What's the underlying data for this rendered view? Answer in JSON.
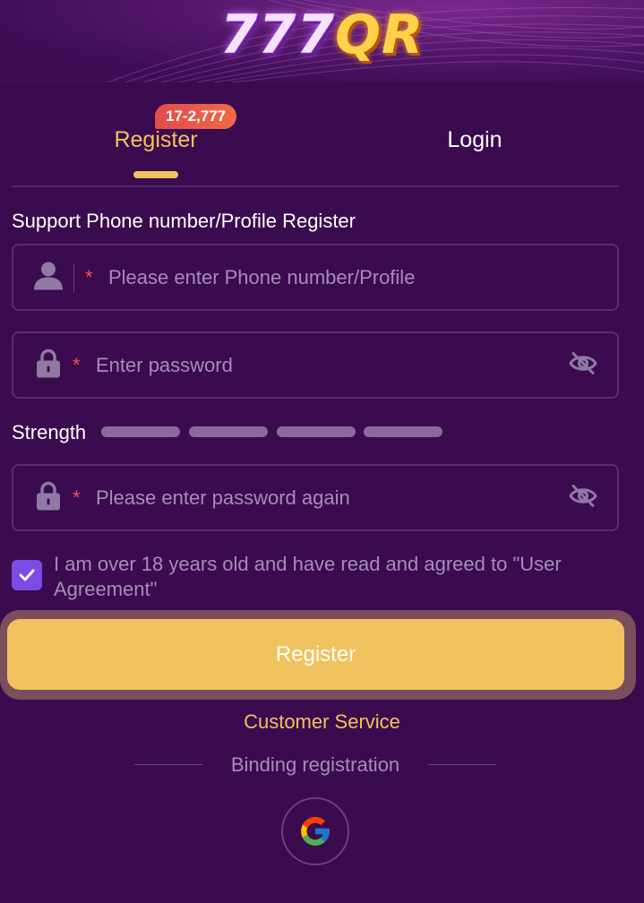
{
  "header": {
    "logo_digits": "777",
    "logo_letters": "QR"
  },
  "tabs": {
    "register_label": "Register",
    "login_label": "Login",
    "promo_badge": "17-2,777"
  },
  "form": {
    "section_label": "Support Phone number/Profile Register",
    "phone": {
      "required_mark": "*",
      "placeholder": "Please enter Phone number/Profile",
      "value": ""
    },
    "password": {
      "required_mark": "*",
      "placeholder": "Enter password",
      "value": ""
    },
    "strength_label": "Strength",
    "confirm_password": {
      "required_mark": "*",
      "placeholder": "Please enter password again",
      "value": ""
    },
    "agreement_text": "I am over 18 years old and have read and agreed to \"User Agreement\"",
    "agreement_checked": true,
    "submit_label": "Register"
  },
  "footer": {
    "customer_service": "Customer Service",
    "binding_label": "Binding registration"
  },
  "icons": {
    "user": "user-icon",
    "lock": "lock-icon",
    "eye_off": "eye-off-icon",
    "check": "check-icon",
    "google": "google-icon"
  },
  "colors": {
    "background": "#3a0b4e",
    "accent_gold": "#f2c25e",
    "button": "#f0c35e",
    "checkbox": "#7b4be6",
    "badge": "#e24b4b",
    "required": "#ff4d4d"
  }
}
